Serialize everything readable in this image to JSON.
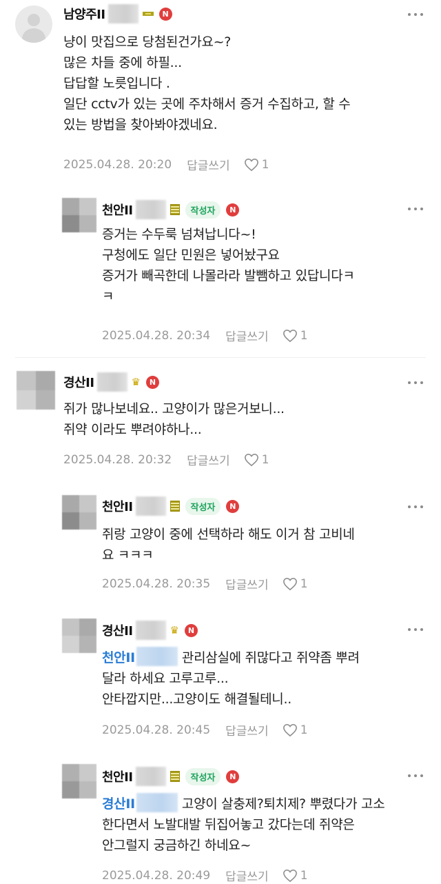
{
  "comments": [
    {
      "nickname": "남양주II",
      "body": [
        "냥이 맛집으로 당첨된건가요~?",
        "많은 차들 중에 하필...",
        "답답할 노릇입니다 .",
        "일단 cctv가 있는 곳에 주차해서 증거 수집하고, 할 수",
        "있는 방법을 찾아봐야겠네요."
      ],
      "date": "2025.04.28. 20:20",
      "reply_label": "답글쓰기",
      "likes": "1"
    },
    {
      "nickname": "천안II",
      "author_badge": "작성자",
      "body": [
        "증거는 수두룩 넘쳐납니다~!",
        "구청에도 일단 민원은 넣어놨구요",
        "증거가 빼곡한데 나몰라라 발뺌하고 있답니다ㅋ",
        "ㅋ"
      ],
      "date": "2025.04.28. 20:34",
      "reply_label": "답글쓰기",
      "likes": "1"
    },
    {
      "nickname": "경산II",
      "body": [
        "쥐가 많나보네요.. 고양이가 많은거보니...",
        "쥐약 이라도 뿌려야하나..."
      ],
      "date": "2025.04.28. 20:32",
      "reply_label": "답글쓰기",
      "likes": "1"
    },
    {
      "nickname": "천안II",
      "author_badge": "작성자",
      "body": [
        "쥐랑 고양이 중에 선택하라 해도 이거 참 고비네",
        "요 ㅋㅋㅋ"
      ],
      "date": "2025.04.28. 20:35",
      "reply_label": "답글쓰기",
      "likes": "1"
    },
    {
      "nickname": "경산II",
      "mention": "천안II",
      "body_first": "관리삼실에 쥐많다고 쥐약좀 뿌려",
      "body": [
        "달라 하세요 고루고루...",
        "안타깝지만...고양이도 해결될테니.."
      ],
      "date": "2025.04.28. 20:45",
      "reply_label": "답글쓰기",
      "likes": "1"
    },
    {
      "nickname": "천안II",
      "author_badge": "작성자",
      "mention": "경산II",
      "body_first": "고양이 살충제?퇴치제? 뿌렸다가 고소",
      "body": [
        "한다면서 노발대발 뒤집어놓고 갔다는데 쥐약은",
        "안그럴지 궁금하긴 하네요~"
      ],
      "date": "2025.04.28. 20:49",
      "reply_label": "답글쓰기",
      "likes": "1"
    }
  ],
  "new_badge": "N",
  "icons": {
    "more": "more-dots-icon",
    "like": "heart-icon"
  },
  "colors": {
    "author_badge_bg": "#e8f6ec",
    "author_badge_text": "#1da35c",
    "new_badge": "#e03d3d",
    "mention": "#2a7cd4",
    "meta": "#9a9a9a"
  }
}
